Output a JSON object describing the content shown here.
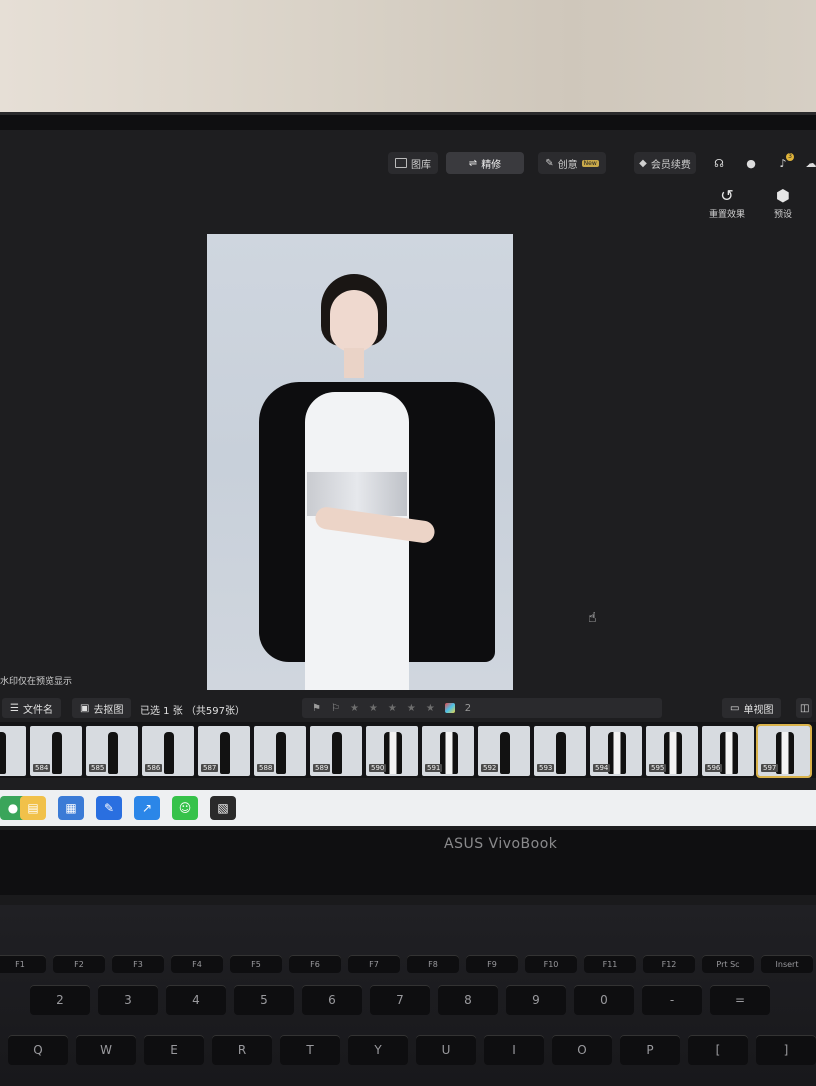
{
  "app": {
    "tabs": [
      {
        "label": "图库"
      },
      {
        "label": "精修"
      },
      {
        "label": "创意",
        "badge": "New"
      }
    ],
    "membership_label": "会员续费",
    "notification_count": "3",
    "actions": [
      {
        "label": "重置效果",
        "icon": "reset-icon"
      },
      {
        "label": "预设",
        "icon": "preset-icon"
      }
    ],
    "watermark_note": "水印仅在预览显示",
    "bottom": {
      "filename_label": "文件名",
      "cutout_label": "去抠图",
      "selected_text": "已选 1 张 （共597张）",
      "rating_text": "2",
      "single_view_label": "单视图"
    },
    "thumbnails": [
      "584",
      "585",
      "586",
      "587",
      "588",
      "589",
      "590",
      "591",
      "592",
      "593",
      "594",
      "595",
      "596",
      "597"
    ]
  },
  "device": {
    "brand": "ASUS VivoBook"
  },
  "keyboard": {
    "fn_row": [
      "F1",
      "F2",
      "F3",
      "F4",
      "F5",
      "F6",
      "F7",
      "F8",
      "F9",
      "F10",
      "F11",
      "F12",
      "Prt Sc",
      "Insert"
    ],
    "num_row": [
      "2",
      "3",
      "4",
      "5",
      "6",
      "7",
      "8",
      "9",
      "0",
      "-",
      "="
    ],
    "letter_row": [
      "Q",
      "W",
      "E",
      "R",
      "T",
      "Y",
      "U",
      "I",
      "O",
      "P",
      "[",
      "]"
    ]
  },
  "colors": {
    "accent": "#d9b24a",
    "screen_bg": "#1e1e20"
  }
}
